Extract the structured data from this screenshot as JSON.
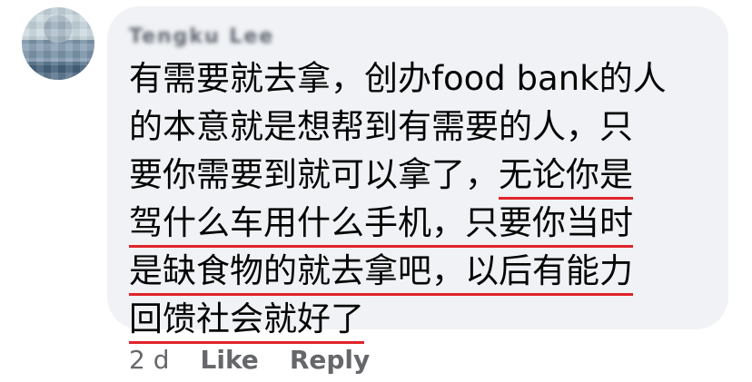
{
  "comment": {
    "author_name": "Tengku Lee",
    "lines": [
      {
        "plain": "有需要就去拿，创办food bank的人",
        "underlined": ""
      },
      {
        "plain": "的本意就是想帮到有需要的人，只",
        "underlined": ""
      },
      {
        "plain": "要你需要到就可以拿了，",
        "underlined": "无论你是"
      },
      {
        "plain": "",
        "underlined": "驾什么车用什么手机，只要你当时"
      },
      {
        "plain": "",
        "underlined": "是缺食物的就去拿吧，以后有能力"
      },
      {
        "plain": "",
        "underlined": "回馈社会就好了"
      }
    ],
    "underline_color": "#e0242b"
  },
  "actions": {
    "timestamp": "2 d",
    "like_label": "Like",
    "reply_label": "Reply"
  },
  "colors": {
    "bubble": "#f0f2f5",
    "text": "#050505",
    "secondary": "#65676b"
  }
}
